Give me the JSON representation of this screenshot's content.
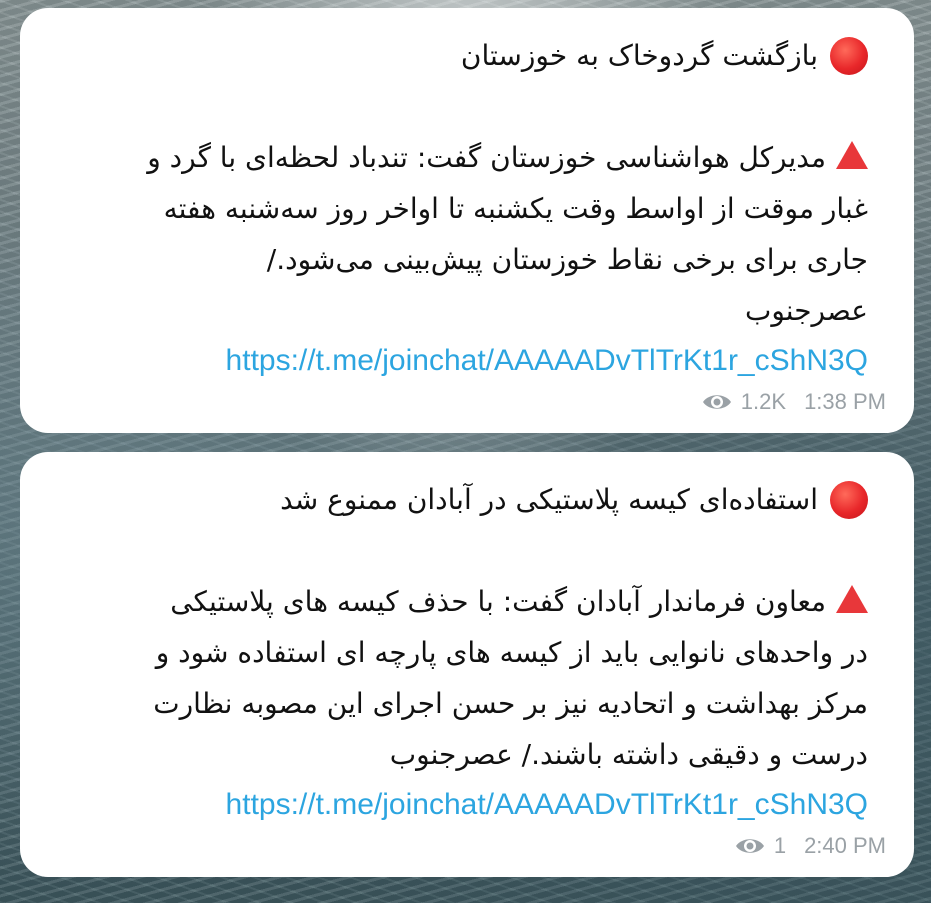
{
  "messages": [
    {
      "headline": "بازگشت گردوخاک به خوزستان",
      "body_lines": [
        "مدیرکل هواشناسی خوزستان گفت: تندباد لحظه‌ای با گرد و",
        "غبار موقت از اواسط وقت یکشنبه تا اواخر روز سه‌شنبه هفته",
        "جاری برای برخی نقاط خوزستان پیش‌بینی می‌شود./",
        "عصرجنوب"
      ],
      "link": "https://t.me/joinchat/AAAAADvTlTrKt1r_cShN3Q",
      "views": "1.2K",
      "time": "1:38 PM"
    },
    {
      "headline": "استفاده‌ای کیسه پلاستیکی در آبادان ممنوع شد",
      "body_lines": [
        "معاون فرماندار آبادان گفت: با حذف کیسه های پلاستیکی",
        "در واحدهای نانوایی باید از کیسه های پارچه ای استفاده شود و",
        "مرکز بهداشت و اتحادیه نیز بر حسن اجرای این مصوبه نظارت",
        "درست و دقیقی داشته باشند./ عصرجنوب"
      ],
      "link": "https://t.me/joinchat/AAAAADvTlTrKt1r_cShN3Q",
      "views": "1",
      "time": "2:40 PM"
    }
  ],
  "icons": {
    "headline_marker": "red-circle-icon",
    "body_marker": "red-triangle-icon",
    "views": "eye-icon"
  },
  "colors": {
    "link": "#2ca5e0",
    "meta": "#9aa1a6",
    "marker_red": "#e8272a",
    "bubble": "#ffffff"
  }
}
